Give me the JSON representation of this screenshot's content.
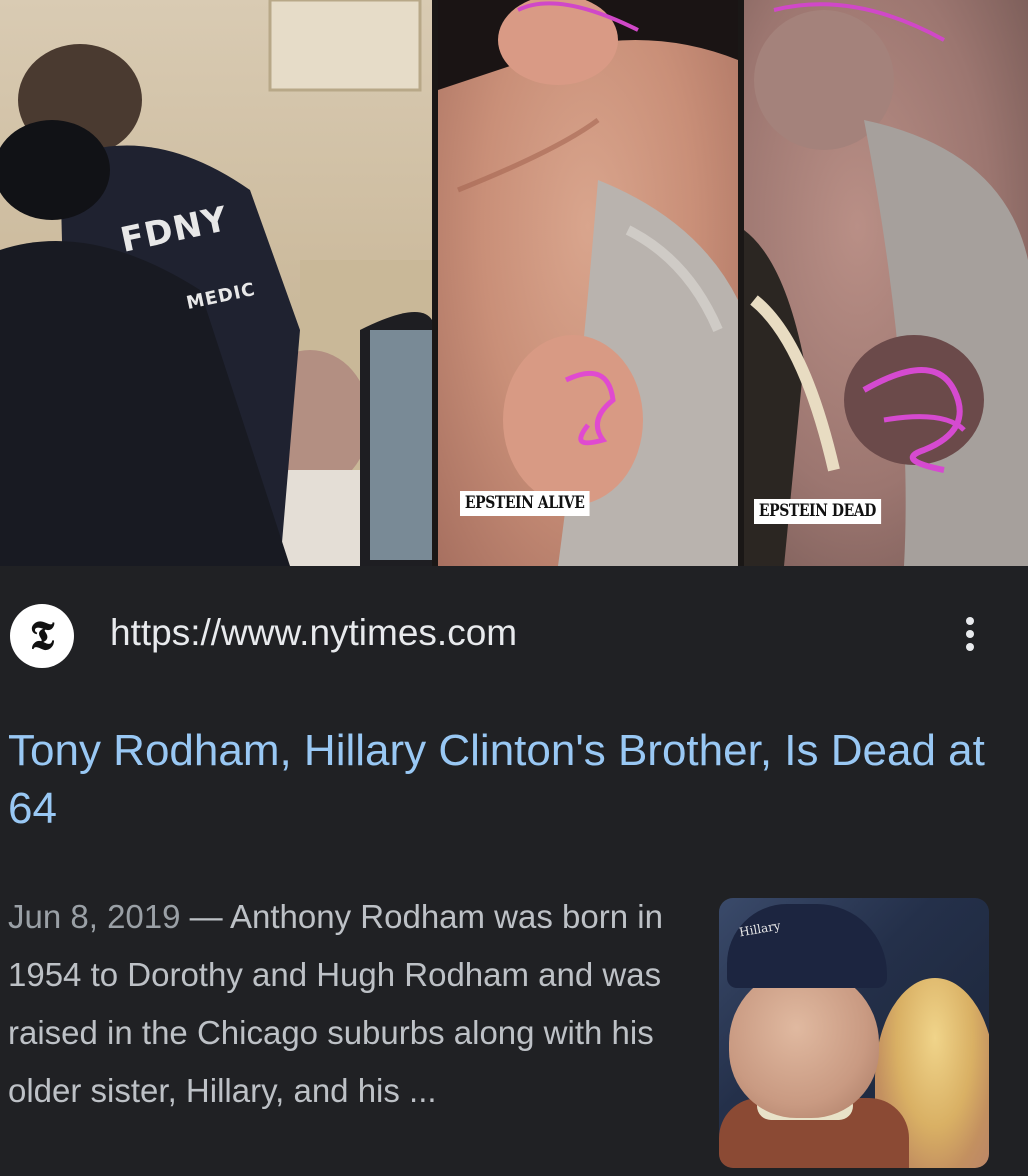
{
  "images": {
    "jacket_line1": "FDNY",
    "jacket_line2": "MEDIC",
    "label_alive": "EPSTEIN ALIVE",
    "label_dead": "EPSTEIN DEAD"
  },
  "result": {
    "favicon_glyph": "𝕿",
    "url": "https://www.nytimes.com",
    "title": "Tony Rodham, Hillary Clinton's Brother, Is Dead at 64",
    "date": "Jun 8, 2019",
    "separator": " — ",
    "snippet": "Anthony Rodham was born in 1954 to Dorothy and Hugh Rodham and was raised in the Chicago suburbs along with his older sister, Hillary, and his ...",
    "thumbnail_cap_text": "Hillary"
  },
  "icons": {
    "favicon": "nytimes-logo-icon",
    "menu": "more-vert-icon"
  },
  "colors": {
    "background": "#202124",
    "title": "#99c8f4",
    "url": "#e8eaed",
    "snippet": "#bdc1c6",
    "date": "#9aa0a6"
  }
}
